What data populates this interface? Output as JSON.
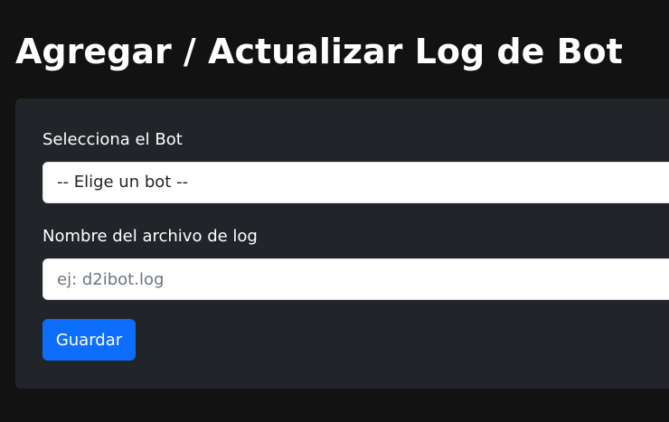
{
  "header": {
    "title": "Agregar / Actualizar Log de Bot"
  },
  "form": {
    "bot_field": {
      "label": "Selecciona el Bot",
      "selected": "-- Elige un bot --"
    },
    "log_field": {
      "label": "Nombre del archivo de log",
      "value": "",
      "placeholder": "ej: d2ibot.log"
    },
    "save_label": "Guardar"
  },
  "colors": {
    "page_background": "#121212",
    "card_background": "#212529",
    "button_primary": "#0d6efd",
    "text": "#ffffff"
  }
}
